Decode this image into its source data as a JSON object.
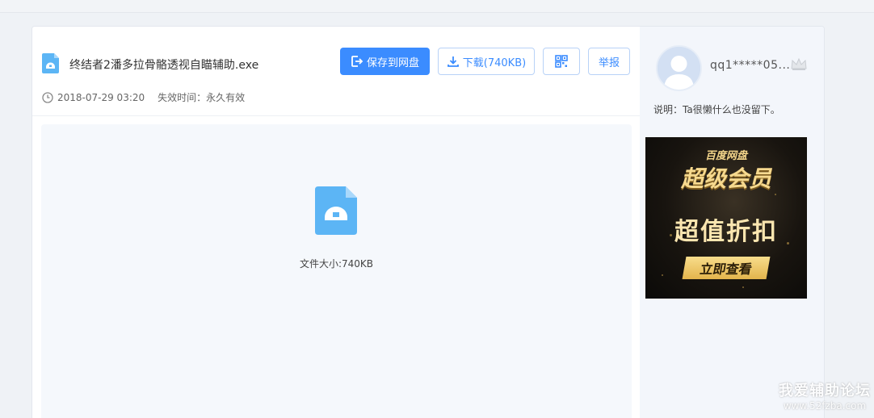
{
  "file": {
    "name": "终结者2潘多拉骨骼透视自瞄辅助.exe",
    "date": "2018-07-29 03:20",
    "expire": "失效时间：永久有效",
    "size_label": "文件大小:740KB"
  },
  "toolbar": {
    "save_label": "保存到网盘",
    "download_label": "下载(740KB)",
    "report_label": "举报"
  },
  "sidebar": {
    "username": "qq1*****05...",
    "description": "说明：Ta很懒什么也没留下。"
  },
  "ad": {
    "brand": "百度网盘",
    "title": "超级会员",
    "slogan": "超值折扣",
    "cta": "立即查看"
  },
  "watermark": {
    "title": "我爱辅助论坛",
    "url": "www.52fzba.com"
  },
  "colors": {
    "accent": "#3b8cff",
    "file_icon": "#5cb5f5"
  }
}
